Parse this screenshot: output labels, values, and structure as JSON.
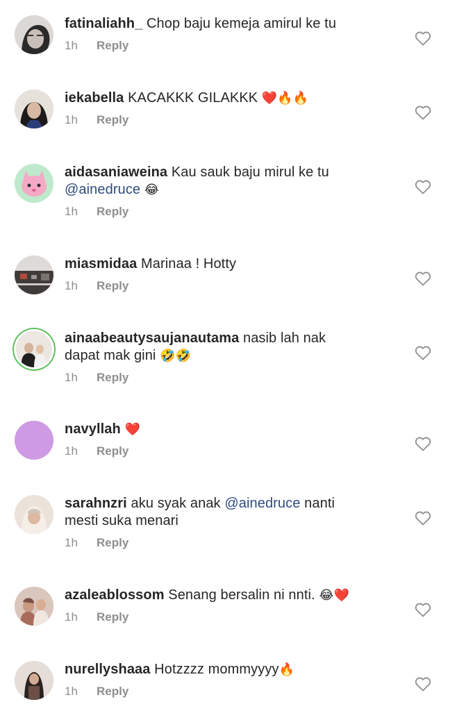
{
  "comments": [
    {
      "username": "fatinaliahh_",
      "text": "Chop baju kemeja amirul ke tu",
      "line2": "",
      "mention": "",
      "emojis": "",
      "time": "1h",
      "reply_label": "Reply",
      "avatar_color": "#d8d4d2"
    },
    {
      "username": "iekabella",
      "text": "KACAKKK GILAKKK",
      "line2": "",
      "mention": "",
      "emojis": "❤️🔥🔥",
      "time": "1h",
      "reply_label": "Reply",
      "avatar_color": "#6b5447"
    },
    {
      "username": "aidasaniaweina",
      "text": "Kau sauk baju mirul ke tu",
      "line2": "",
      "mention": "@ainedruce",
      "emojis": "😂",
      "time": "1h",
      "reply_label": "Reply",
      "avatar_color": "#b8e8c8"
    },
    {
      "username": "miasmidaa",
      "text": "Marinaa ! Hotty",
      "line2": "",
      "mention": "",
      "emojis": "",
      "time": "1h",
      "reply_label": "Reply",
      "avatar_color": "#4a4544"
    },
    {
      "username": "ainaabeautysaujanautama",
      "text": "nasib lah nak",
      "line2": "dapat mak gini",
      "mention": "",
      "emojis": "🤣🤣",
      "time": "1h",
      "reply_label": "Reply",
      "avatar_color": "#e9e4dd"
    },
    {
      "username": "navyllah",
      "text": "",
      "line2": "",
      "mention": "",
      "emojis": "❤️",
      "time": "1h",
      "reply_label": "Reply",
      "avatar_color": "#cf9ae4"
    },
    {
      "username": "sarahnzri",
      "text": "aku syak anak",
      "line2": "mesti suka menari",
      "mention": "@ainedruce",
      "mention_after": "nanti",
      "emojis": "",
      "time": "1h",
      "reply_label": "Reply",
      "avatar_color": "#e8d9cc"
    },
    {
      "username": "azaleablossom",
      "text": "Senang bersalin ni nnti.",
      "line2": "",
      "mention": "",
      "emojis": "😂❤️",
      "time": "1h",
      "reply_label": "Reply",
      "avatar_color": "#c9a08f"
    },
    {
      "username": "nurellyshaaa",
      "text": "Hotzzzz mommyyyy",
      "line2": "",
      "mention": "",
      "emojis": "🔥",
      "time": "1h",
      "reply_label": "Reply",
      "avatar_color": "#5f4d46"
    }
  ]
}
